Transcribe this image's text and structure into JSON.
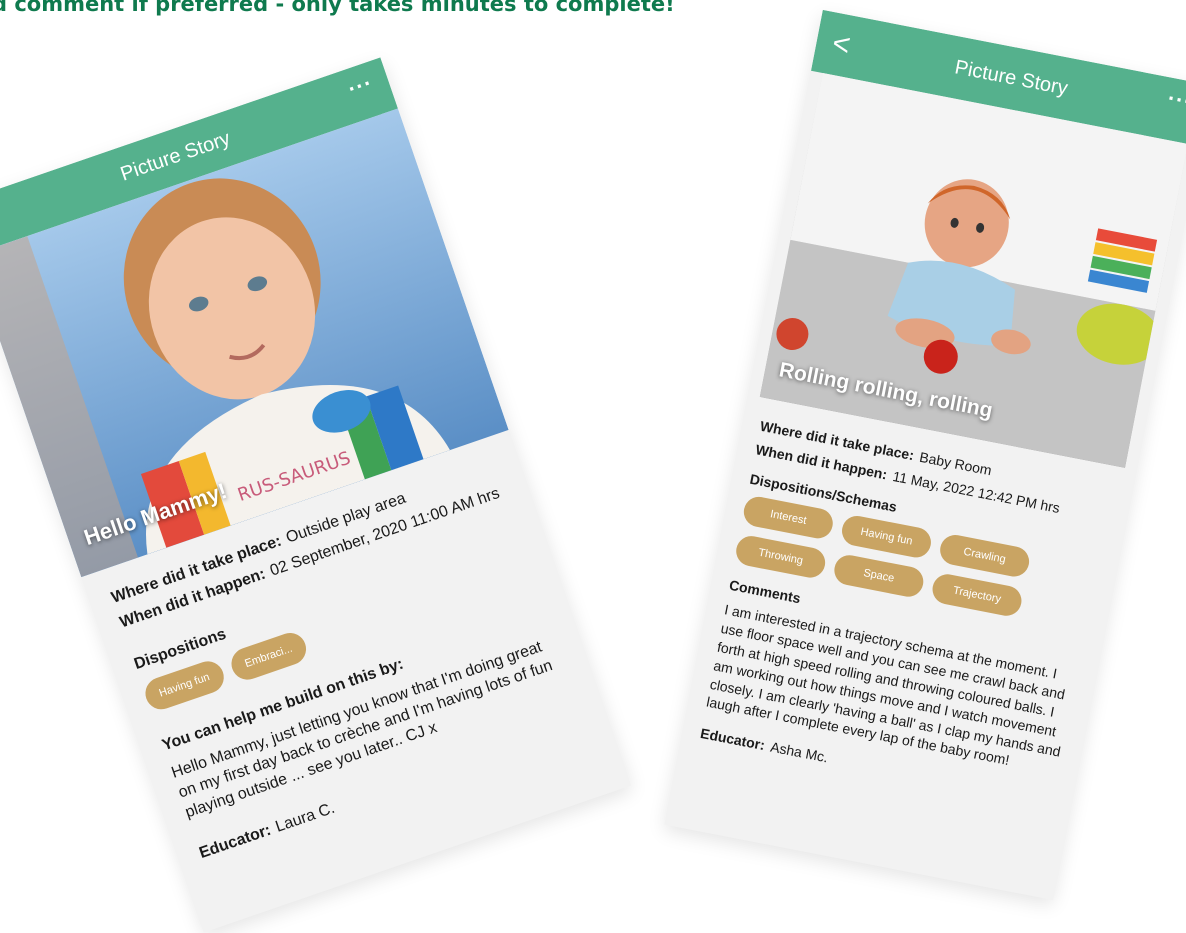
{
  "banner_text": "d comment if preferred - only takes minutes to complete!",
  "colors": {
    "appbar": "#55b18d",
    "chip": "#c9a463",
    "banner": "#0f7a4e",
    "card_bg": "#f2f2f2"
  },
  "icons": {
    "back": "chevron-left-icon",
    "more": "more-horizontal-icon"
  },
  "left_story": {
    "back_glyph": "<",
    "title": "Picture Story",
    "more_glyph": "...",
    "caption": "Hello Mammy!",
    "where_label": "Where did it take place:",
    "where_value": "Outside play area",
    "when_label": "When did it happen:",
    "when_value": "02 September, 2020 11:00 AM hrs",
    "dispositions_heading": "Dispositions",
    "chips": [
      "Having fun",
      "Embraci..."
    ],
    "help_heading": "You can help me build on this by:",
    "help_text": "Hello Mammy, just letting you know that I'm doing great on my first day back to crèche and I'm having lots of fun playing outside ... see you later.. CJ x",
    "educator_label": "Educator:",
    "educator_value": "Laura C."
  },
  "right_story": {
    "back_glyph": "<",
    "title": "Picture Story",
    "more_glyph": "...",
    "caption": "Rolling rolling, rolling",
    "where_label": "Where did it take place:",
    "where_value": "Baby Room",
    "when_label": "When did it happen:",
    "when_value": "11 May, 2022 12:42 PM hrs",
    "schemas_heading": "Dispositions/Schemas",
    "chips": [
      "Interest",
      "Having fun",
      "Crawling",
      "Throwing",
      "Space",
      "Trajectory"
    ],
    "comments_heading": "Comments",
    "comments_text": "I am interested in a trajectory schema at the moment. I use floor space well and you can see me crawl back and forth at high speed rolling and throwing coloured balls. I am working out how things move and I watch movement closely.  I am clearly 'having a ball' as I clap my hands and laugh after I complete every lap of the baby room!",
    "educator_label": "Educator:",
    "educator_value": "Asha Mc."
  }
}
